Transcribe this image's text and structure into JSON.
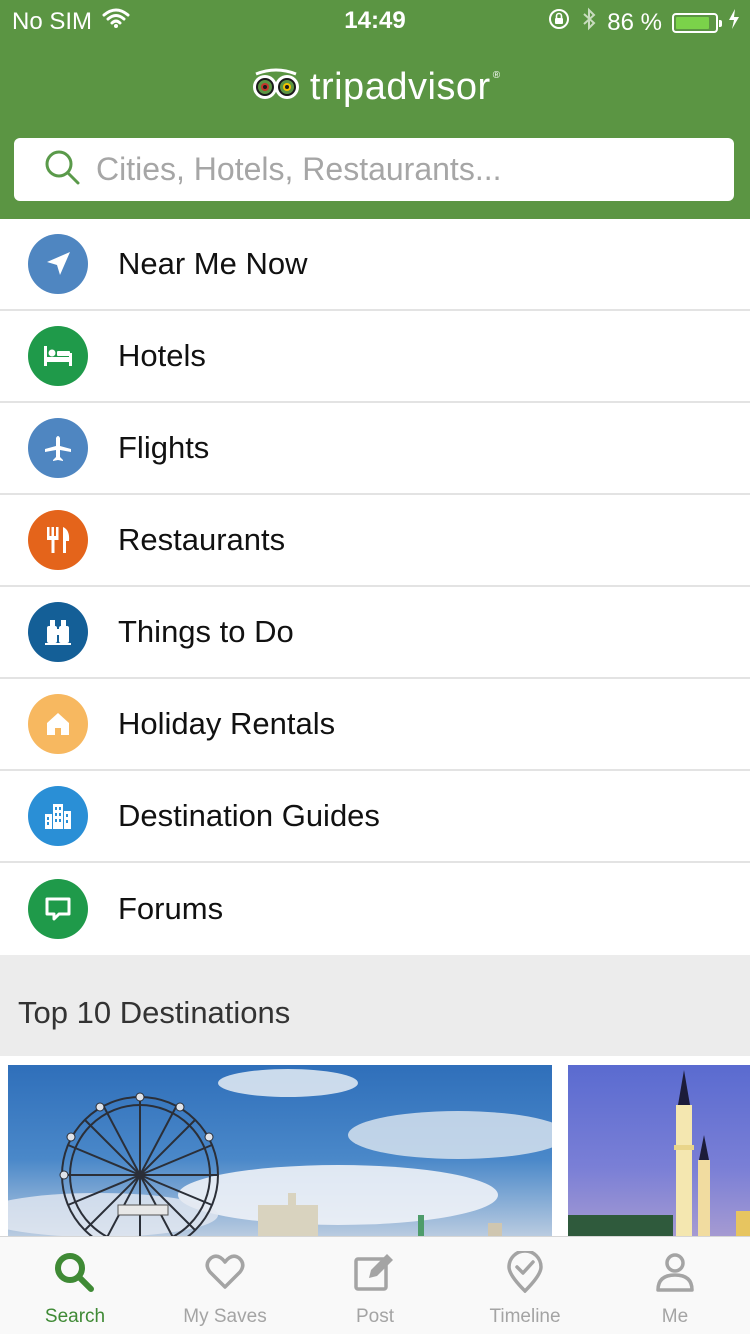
{
  "status_bar": {
    "carrier": "No SIM",
    "time": "14:49",
    "battery_percent": "86 %",
    "battery_level": 0.86
  },
  "header": {
    "brand": "tripadvisor",
    "brand_mark": "®",
    "background_color": "#5b9543"
  },
  "search": {
    "placeholder": "Cities, Hotels, Restaurants..."
  },
  "menu": {
    "items": [
      {
        "label": "Near Me Now",
        "icon": "navigation-arrow-icon",
        "color": "#4f86c1"
      },
      {
        "label": "Hotels",
        "icon": "bed-icon",
        "color": "#1f9a4a"
      },
      {
        "label": "Flights",
        "icon": "airplane-icon",
        "color": "#4f86c1"
      },
      {
        "label": "Restaurants",
        "icon": "fork-knife-icon",
        "color": "#e4641b"
      },
      {
        "label": "Things to Do",
        "icon": "binoculars-icon",
        "color": "#145f97"
      },
      {
        "label": "Holiday Rentals",
        "icon": "house-icon",
        "color": "#f7b860"
      },
      {
        "label": "Destination Guides",
        "icon": "city-buildings-icon",
        "color": "#2a8fd6"
      },
      {
        "label": "Forums",
        "icon": "chat-bubble-icon",
        "color": "#1f9a4a"
      }
    ]
  },
  "top_destinations": {
    "title": "Top 10 Destinations"
  },
  "tab_bar": {
    "tabs": [
      {
        "label": "Search",
        "icon": "search-icon",
        "active": true
      },
      {
        "label": "My Saves",
        "icon": "heart-icon",
        "active": false
      },
      {
        "label": "Post",
        "icon": "edit-post-icon",
        "active": false
      },
      {
        "label": "Timeline",
        "icon": "location-check-icon",
        "active": false
      },
      {
        "label": "Me",
        "icon": "person-icon",
        "active": false
      }
    ],
    "active_color": "#3f8a35",
    "inactive_color": "#a4a4a4"
  }
}
